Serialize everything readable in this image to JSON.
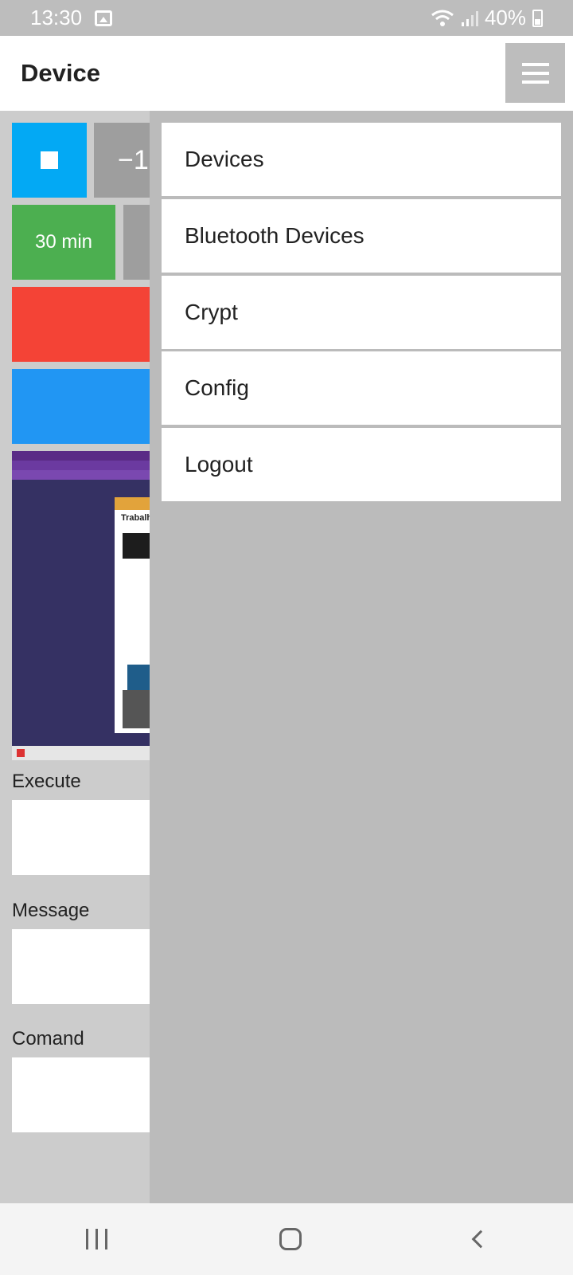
{
  "status_bar": {
    "time": "13:30",
    "battery": "40%"
  },
  "app_bar": {
    "title": "Device"
  },
  "tiles": {
    "minus_label": "−1",
    "timer_label": "30 min",
    "stop_color": "#03a9f4",
    "timer_color": "#4caf50",
    "red_color": "#f44336",
    "blue_color": "#2196f3"
  },
  "preview": {
    "window_title": "Trabalh"
  },
  "fields": {
    "execute_label": "Execute",
    "message_label": "Message",
    "comand_label": "Comand"
  },
  "drawer": {
    "items": [
      {
        "label": "Devices"
      },
      {
        "label": "Bluetooth Devices"
      },
      {
        "label": "Crypt"
      },
      {
        "label": "Config"
      },
      {
        "label": "Logout"
      }
    ]
  }
}
